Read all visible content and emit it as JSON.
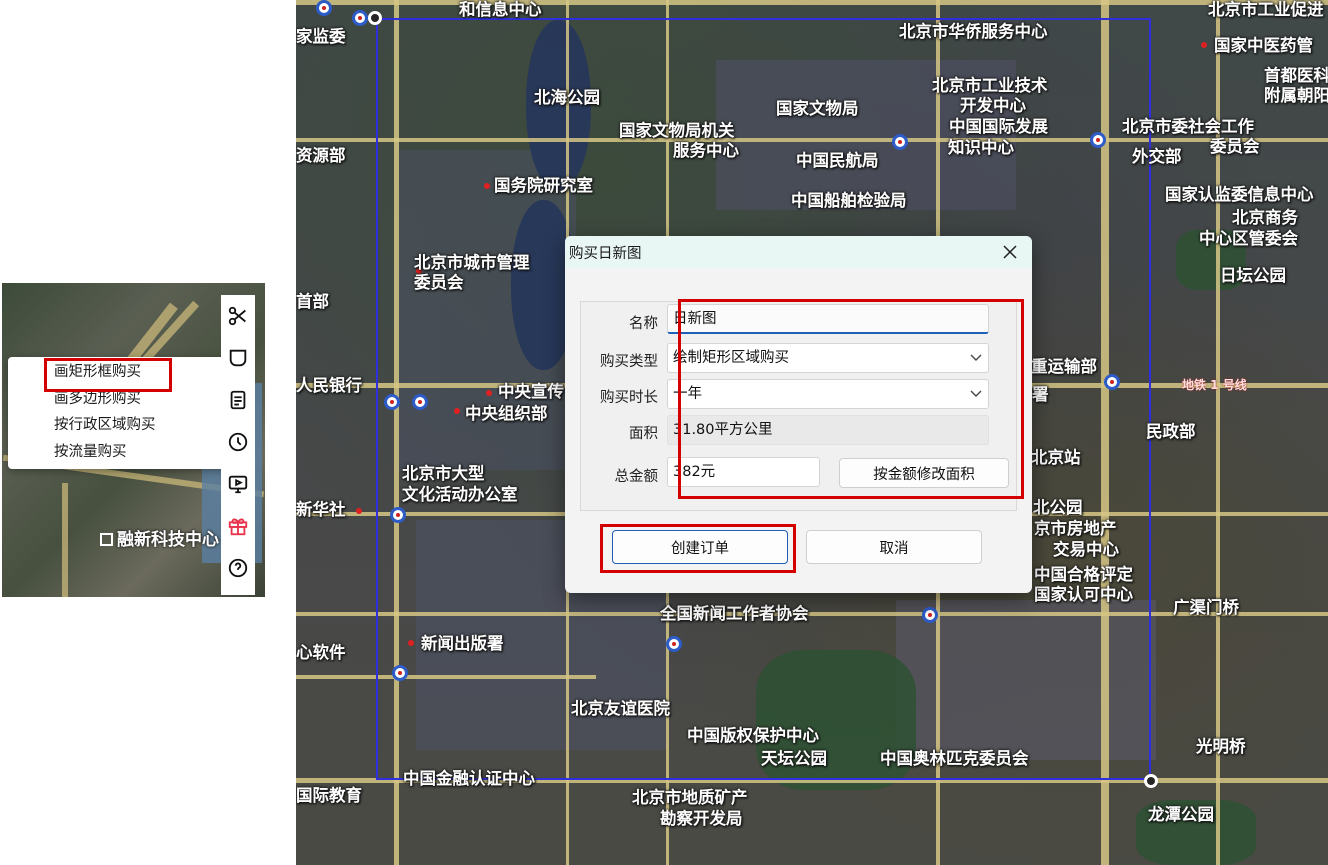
{
  "context_menu": {
    "items": [
      {
        "label": "画矩形框购买",
        "highlighted": true
      },
      {
        "label": "画多边形购买",
        "highlighted": false
      },
      {
        "label": "按行政区域购买",
        "highlighted": false
      },
      {
        "label": "按流量购买",
        "highlighted": false
      }
    ]
  },
  "inset_map": {
    "label": "融新科技中心"
  },
  "toolbar": {
    "icons": [
      "scissors-icon",
      "shape-icon",
      "document-icon",
      "history-icon",
      "screen-icon",
      "gift-icon",
      "help-icon"
    ],
    "gift_color": "#e8334a"
  },
  "map": {
    "labels": [
      "和信息中心",
      "北京市工业促进",
      "家监委",
      "北京市华侨服务中心",
      "国家中医药管",
      "首都医科",
      "附属朝阳",
      "北海公园",
      "北京市工业技术",
      "开发中心",
      "国家文物局",
      "国家文物局机关",
      "服务中心",
      "中国国际发展",
      "知识中心",
      "北京市委社会工作",
      "委员会",
      "资源部",
      "中国民航局",
      "外交部",
      "国务院研究室",
      "国家认监委信息中心",
      "中国船舶检验局",
      "北京商务",
      "中心区管委会",
      "日坛公园",
      "北京市城市管理",
      "委员会",
      "首部",
      "重运输部",
      "人民银行",
      "中央宣传",
      "中央组织部",
      "署",
      "民政部",
      "北京市大型",
      "文化活动办公室",
      "北京站",
      "新华社",
      "北公园",
      "京市房地产",
      "交易中心",
      "中国合格评定",
      "国家认可中心",
      "全国新闻工作者协会",
      "广渠门桥",
      "新闻出版署",
      "心软件",
      "北京友谊医院",
      "中国版权保护中心",
      "天坛公园",
      "中国奥林匹克委员会",
      "光明桥",
      "中国金融认证中心",
      "国际教育",
      "北京市地质矿产",
      "勘察开发局",
      "龙潭公园"
    ],
    "metro_line_label": "地铁 1 号线",
    "selection_color": "#2f2fe0"
  },
  "dialog": {
    "title": "购买日新图",
    "name_label": "名称",
    "name_value": "日新图",
    "type_label": "购买类型",
    "type_value": "绘制矩形区域购买",
    "duration_label": "购买时长",
    "duration_value": "一年",
    "area_label": "面积",
    "area_value": "31.80平方公里",
    "amount_label": "总金额",
    "amount_value": "382元",
    "modify_button": "按金额修改面积",
    "create_button": "创建订单",
    "cancel_button": "取消"
  },
  "highlight_color": "#d40000"
}
